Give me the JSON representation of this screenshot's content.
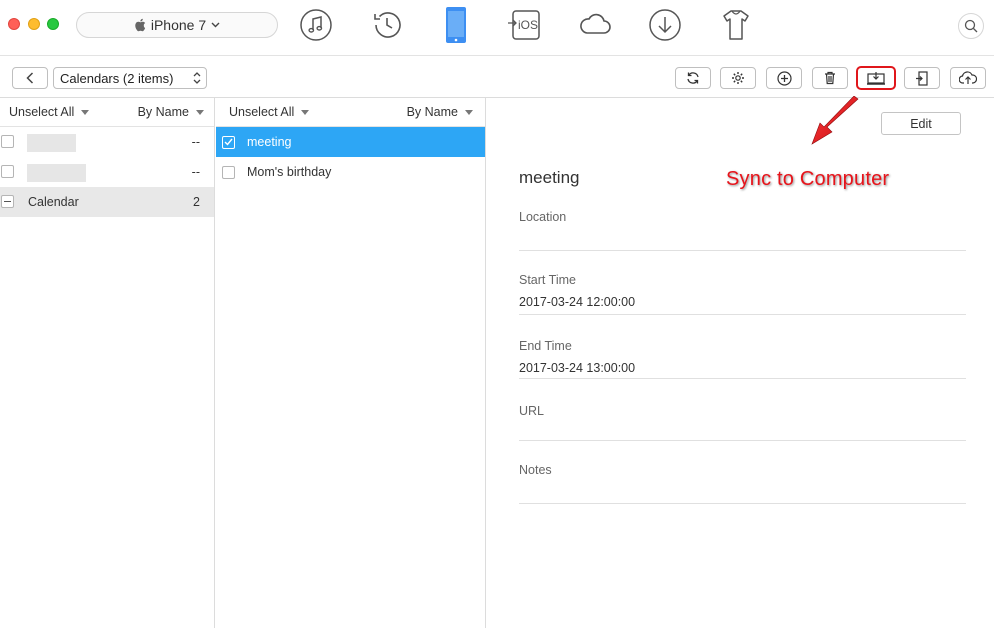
{
  "topbar": {
    "device_name": "iPhone 7",
    "nav_icons": [
      "music-icon",
      "history-icon",
      "device-icon",
      "ios-mover-icon",
      "icloud-icon",
      "download-icon",
      "toolbox-icon"
    ],
    "search_icon": "search-icon"
  },
  "toolbar": {
    "calendar_select": "Calendars (2 items)",
    "buttons": [
      "refresh-icon",
      "settings-icon",
      "add-icon",
      "delete-icon",
      "sync-to-computer-icon",
      "export-icon",
      "upload-cloud-icon"
    ]
  },
  "col1": {
    "unselect_all": "Unselect All",
    "sort": "By Name",
    "rows": [
      {
        "label": "",
        "count": "--"
      },
      {
        "label": "",
        "count": "--"
      },
      {
        "label": "Calendar",
        "count": "2"
      }
    ]
  },
  "col2": {
    "unselect_all": "Unselect All",
    "sort": "By Name",
    "rows": [
      {
        "label": "meeting",
        "checked": true
      },
      {
        "label": "Mom's birthday",
        "checked": false
      }
    ]
  },
  "detail": {
    "edit_label": "Edit",
    "title": "meeting",
    "location_label": "Location",
    "location_value": "",
    "start_label": "Start Time",
    "start_value": "2017-03-24 12:00:00",
    "end_label": "End Time",
    "end_value": "2017-03-24 13:00:00",
    "url_label": "URL",
    "url_value": "",
    "notes_label": "Notes",
    "notes_value": ""
  },
  "annotation": "Sync to Computer",
  "colors": {
    "accent": "#2da6f5",
    "highlight": "#e0161b",
    "annotation": "#e8131a"
  }
}
